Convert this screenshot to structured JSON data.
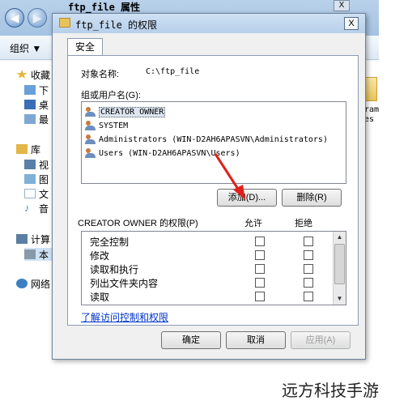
{
  "explorer": {
    "title": "ftp_file 属性",
    "close_label": "X",
    "toolbar": {
      "organize_label": "组织 ▼"
    },
    "nav_items": [
      {
        "label": "收藏",
        "icon": "star-icon",
        "color": "#e4b43a"
      },
      {
        "label": "下",
        "icon": "download-folder-icon",
        "color": "#6aa0d8"
      },
      {
        "label": "桌",
        "icon": "desktop-icon",
        "color": "#3b6fb5"
      },
      {
        "label": "最",
        "icon": "recent-icon",
        "color": "#7ea8d1"
      },
      {
        "label": "库",
        "icon": "library-icon",
        "color": "#e3b64a"
      },
      {
        "label": "视",
        "icon": "video-icon",
        "color": "#5a7fa8"
      },
      {
        "label": "图",
        "icon": "picture-icon",
        "color": "#7fb0d8"
      },
      {
        "label": "文",
        "icon": "document-icon",
        "color": "#9ab2cc"
      },
      {
        "label": "音",
        "icon": "music-icon",
        "color": "#4c86c8"
      },
      {
        "label": "计算",
        "icon": "computer-icon",
        "color": "#5b7fa3"
      },
      {
        "label": "本",
        "icon": "drive-icon",
        "color": "#8899aa"
      },
      {
        "label": "网络",
        "icon": "network-icon",
        "color": "#3d7fc1"
      }
    ],
    "file_peek_text": [
      "gram",
      "les"
    ]
  },
  "dialog": {
    "title": "ftp_file 的权限",
    "close_label": "X",
    "tab_label": "安全",
    "object_name_label": "对象名称:",
    "object_name_value": "C:\\ftp_file",
    "group_label": "组或用户名(G):",
    "users": [
      {
        "name": "CREATOR OWNER",
        "selected": true
      },
      {
        "name": "SYSTEM",
        "selected": false
      },
      {
        "name": "Administrators (WIN-D2AH6APASVN\\Administrators)",
        "selected": false
      },
      {
        "name": "Users (WIN-D2AH6APASVN\\Users)",
        "selected": false
      }
    ],
    "add_button": "添加(D)...",
    "remove_button": "删除(R)",
    "perm_header": "CREATOR OWNER 的权限(P)",
    "allow_header": "允许",
    "deny_header": "拒绝",
    "permissions": [
      {
        "name": "完全控制",
        "allow": false,
        "deny": false
      },
      {
        "name": "修改",
        "allow": false,
        "deny": false
      },
      {
        "name": "读取和执行",
        "allow": false,
        "deny": false
      },
      {
        "name": "列出文件夹内容",
        "allow": false,
        "deny": false
      },
      {
        "name": "读取",
        "allow": false,
        "deny": false
      }
    ],
    "link_text": "了解访问控制和权限",
    "ok_button": "确定",
    "cancel_button": "取消",
    "apply_button": "应用(A)"
  },
  "annotation": {
    "arrow_color": "#e0201a"
  },
  "watermark": "远方科技手游"
}
